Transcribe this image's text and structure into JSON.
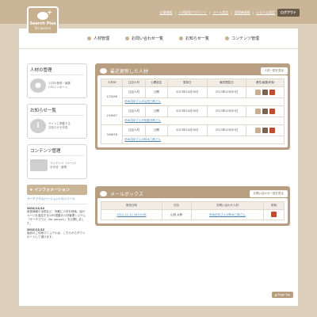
{
  "logo": {
    "title": "Search Plus",
    "subtitle": "for person"
  },
  "toplinks": [
    "企業情報",
    "人材管理アカウント",
    "メール設定",
    "管理者情報",
    "システム設定"
  ],
  "logout": "ログアウト",
  "nav": [
    "人材管理",
    "お問い合わせ一覧",
    "お知らせ一覧",
    "コンテンツ管理"
  ],
  "left": {
    "box1": {
      "title": "人材の管理",
      "text": "人材の登録・編集\nCSVインポート"
    },
    "box2": {
      "title": "お知らせ一覧",
      "text": "サイトに掲載する\nお知らせを作成"
    },
    "box3": {
      "title": "コンテンツ管理",
      "text": "コンテンツ（ページ）\nを作成・管理"
    }
  },
  "info": {
    "heading": "インフォメーション",
    "link": "サーチプラス(バージョン1.0)リリース",
    "items": [
      {
        "date": "2012/11/12",
        "text": "家族情報や出勤など、気軽に人材を検索。紹介ページを追加するCMS搭載の人材管理システム「サーチプラス（for person）」を公開しました。"
      },
      {
        "date": "2012/11/12",
        "text": "製品のご利用マニュアルは、こちらからダウンロードして頂けます。"
      }
    ]
  },
  "recent": {
    "title": "最近更新した人材",
    "button": "人材一覧を見る",
    "headers": [
      "人材ID",
      "注目人材",
      "公開設定",
      "更新日",
      "最終閲覧日",
      "着性/編集/削除"
    ],
    "rows": [
      {
        "id": "123456",
        "featured": "注目人材",
        "status": "公開",
        "updated": "2013年10月30日",
        "viewed": "2013年10月30日",
        "name": "鈴木田中さんが山田三郎さん"
      },
      {
        "id": "234567",
        "featured": "注目人材",
        "status": "公開",
        "updated": "2013年10月30日",
        "viewed": "2013年10月30日",
        "name": "鈴木田中さんが佐藤次郎さん"
      },
      {
        "id": "345678",
        "featured": "注目人材",
        "status": "公開",
        "updated": "2013年10月30日",
        "viewed": "2013年10月30日",
        "name": "鈴木田中さんが鈴木三郎さん"
      }
    ]
  },
  "mail": {
    "title": "メールボックス",
    "button": "お問い合わせ一覧を見る",
    "headers": [
      "受信日時",
      "氏名",
      "お問い合わせ人材",
      "削除"
    ],
    "rows": [
      {
        "date": "2012-11-12 16:04:56",
        "name": "山田 太郎",
        "target": "鈴木田中さんが鈴木三郎さん"
      }
    ]
  },
  "pagetop": "Page Top"
}
